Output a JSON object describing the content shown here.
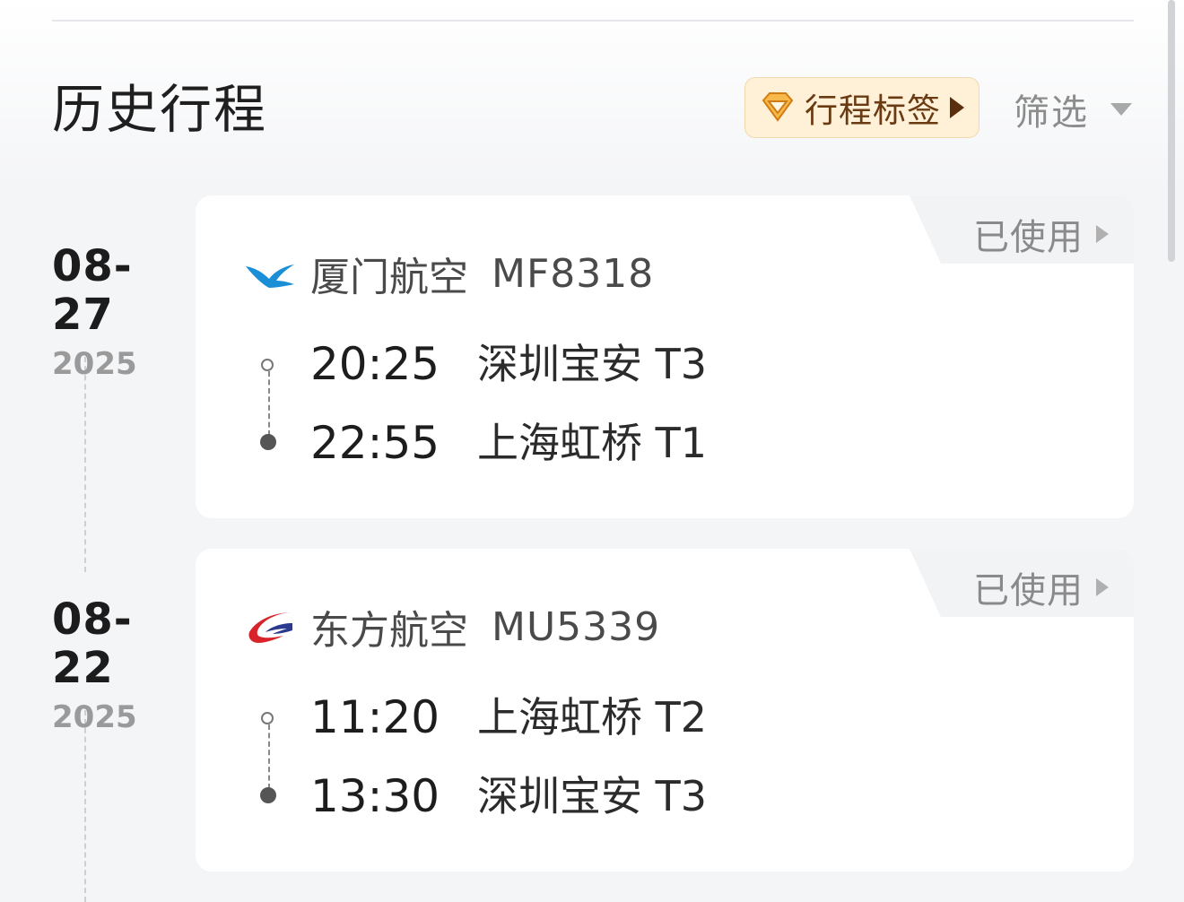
{
  "header": {
    "title": "历史行程",
    "tag_button_label": "行程标签",
    "filter_label": "筛选"
  },
  "colors": {
    "tag_bg": "#fff0d8",
    "tag_text": "#6a3a12",
    "xiamen_blue": "#1a8fd6",
    "eastern_red": "#d8232a",
    "eastern_blue": "#2a3a8f"
  },
  "trips": [
    {
      "date": "08-27",
      "year": "2025",
      "status": "已使用",
      "airline": "厦门航空",
      "airline_icon": "xiamen-airlines-logo",
      "flight_no": "MF8318",
      "depart_time": "20:25",
      "depart_airport": "深圳宝安 T3",
      "arrive_time": "22:55",
      "arrive_airport": "上海虹桥 T1"
    },
    {
      "date": "08-22",
      "year": "2025",
      "status": "已使用",
      "airline": "东方航空",
      "airline_icon": "china-eastern-logo",
      "flight_no": "MU5339",
      "depart_time": "11:20",
      "depart_airport": "上海虹桥 T2",
      "arrive_time": "13:30",
      "arrive_airport": "深圳宝安 T3"
    }
  ]
}
